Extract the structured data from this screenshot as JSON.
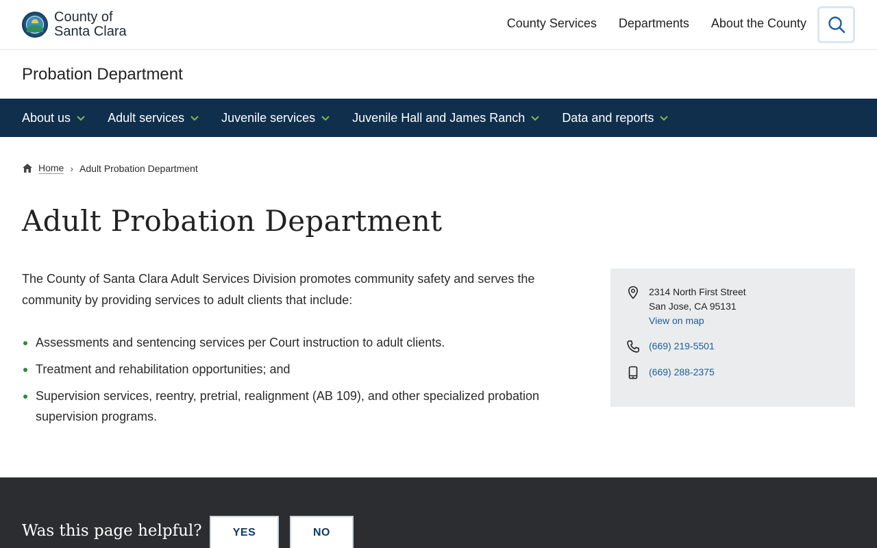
{
  "header": {
    "logo_line1": "County of",
    "logo_line2": "Santa Clara",
    "nav": [
      "County Services",
      "Departments",
      "About the County"
    ],
    "search_icon": "search-icon"
  },
  "department": {
    "title": "Probation Department"
  },
  "main_nav": [
    "About us",
    "Adult services",
    "Juvenile services",
    "Juvenile Hall and James Ranch",
    "Data and reports"
  ],
  "breadcrumb": {
    "home": "Home",
    "current": "Adult Probation Department"
  },
  "page": {
    "title": "Adult Probation Department",
    "intro": "The County of Santa Clara Adult Services Division promotes community safety and serves the community by providing services to adult clients that include:",
    "bullets": [
      "Assessments and sentencing services per Court instruction to adult clients.",
      "Treatment and rehabilitation opportunities; and",
      "Supervision services, reentry, pretrial, realignment (AB 109), and other specialized probation supervision programs."
    ]
  },
  "contact": {
    "address_line1": "2314 North First Street",
    "address_line2": "San Jose, CA 95131",
    "map_link": "View on map",
    "phone": "(669) 219-5501",
    "mobile": "(669) 288-2375"
  },
  "feedback": {
    "question": "Was this page helpful?",
    "yes": "YES",
    "no": "NO"
  },
  "colors": {
    "nav_bg": "#0f2f4d",
    "chevron": "#7bc143",
    "link": "#1c5d99",
    "footer_bg": "#2b2d30"
  }
}
